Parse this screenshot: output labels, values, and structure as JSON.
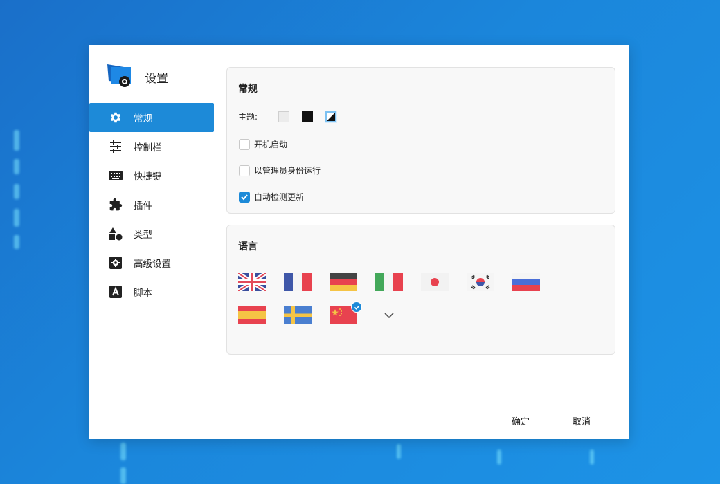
{
  "window": {
    "title": "设置"
  },
  "sidebar": {
    "items": [
      {
        "label": "常规",
        "icon": "gear-icon",
        "active": true
      },
      {
        "label": "控制栏",
        "icon": "sliders-icon",
        "active": false
      },
      {
        "label": "快捷键",
        "icon": "keyboard-icon",
        "active": false
      },
      {
        "label": "插件",
        "icon": "puzzle-icon",
        "active": false
      },
      {
        "label": "类型",
        "icon": "shapes-icon",
        "active": false
      },
      {
        "label": "高级设置",
        "icon": "advanced-gear-icon",
        "active": false
      },
      {
        "label": "脚本",
        "icon": "script-icon",
        "active": false
      }
    ]
  },
  "general": {
    "title": "常规",
    "theme_label": "主题:",
    "themes": [
      "light",
      "dark",
      "auto"
    ],
    "selected_theme": "auto",
    "options": [
      {
        "label": "开机启动",
        "checked": false
      },
      {
        "label": "以管理员身份运行",
        "checked": false
      },
      {
        "label": "自动检测更新",
        "checked": true
      }
    ]
  },
  "language": {
    "title": "语言",
    "flags": [
      "uk",
      "france",
      "germany",
      "italy",
      "japan",
      "korea",
      "russia",
      "spain",
      "sweden",
      "china"
    ],
    "selected": "china",
    "more_icon": "chevron-down-icon"
  },
  "footer": {
    "ok_label": "确定",
    "cancel_label": "取消"
  },
  "colors": {
    "accent": "#1d8ad8",
    "background": "#1b86db"
  }
}
